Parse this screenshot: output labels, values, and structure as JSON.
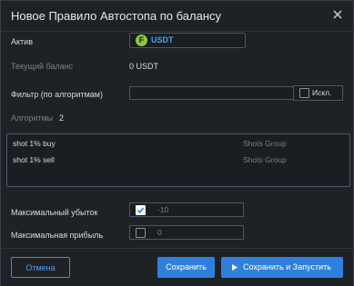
{
  "dialog": {
    "title": "Новое Правило Автостопа по балансу"
  },
  "form": {
    "asset_label": "Актив",
    "asset_value": "USDT",
    "asset_icon_letter": "F",
    "balance_label": "Текущий баланс",
    "balance_value": "0 USDT",
    "filter_label": "Фильтр (по алгоритмам)",
    "filter_value": "",
    "exclude_label": "Искл.",
    "exclude_checked": false,
    "algorithms_label": "Алгоритмы",
    "algorithms_count": "2",
    "algorithms": [
      {
        "name": "shot 1% buy",
        "group": "Shots Group"
      },
      {
        "name": "shot 1% sell",
        "group": "Shots Group"
      }
    ],
    "max_loss_label": "Максимальный убыток",
    "max_loss_checked": true,
    "max_loss_value": "-10",
    "max_profit_label": "Максимальная прибыль",
    "max_profit_checked": false,
    "max_profit_value": "0"
  },
  "footer": {
    "cancel_label": "Отмена",
    "save_label": "Сохранить",
    "save_run_label": "Сохранить и Запустить"
  },
  "colors": {
    "accent": "#2f80dd",
    "asset_icon": "#8dc63f"
  }
}
